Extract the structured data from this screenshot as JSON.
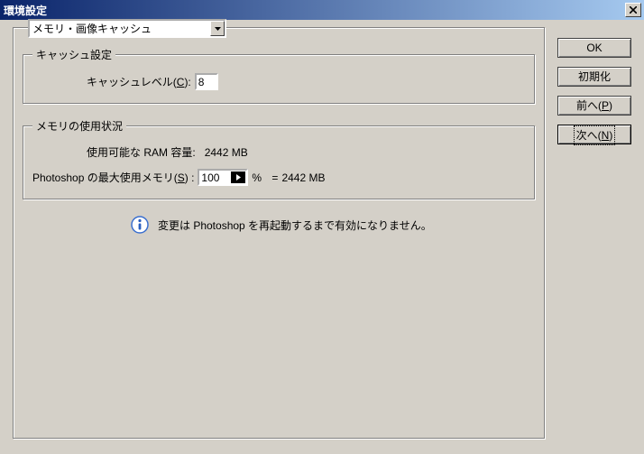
{
  "window": {
    "title": "環境設定"
  },
  "combo": {
    "selected": "メモリ・画像キャッシュ"
  },
  "cache_group": {
    "legend": "キャッシュ設定",
    "level_label_pre": "キャッシュレベル(",
    "level_mnemonic": "C",
    "level_label_post": "):",
    "level_value": "8"
  },
  "memory_group": {
    "legend": "メモリの使用状況",
    "ram_label": "使用可能な RAM 容量:",
    "ram_value": "2442 MB",
    "max_label_pre": "Photoshop の最大使用メモリ(",
    "max_mnemonic": "S",
    "max_label_post": ") :",
    "max_percent": "100",
    "percent_sign": "%",
    "equals": "=",
    "computed": "2442 MB"
  },
  "info_text": "変更は Photoshop を再起動するまで有効になりません。",
  "buttons": {
    "ok": "OK",
    "reset": "初期化",
    "prev_pre": "前へ(",
    "prev_m": "P",
    "prev_post": ")",
    "next_pre": "次へ(",
    "next_m": "N",
    "next_post": ")"
  }
}
